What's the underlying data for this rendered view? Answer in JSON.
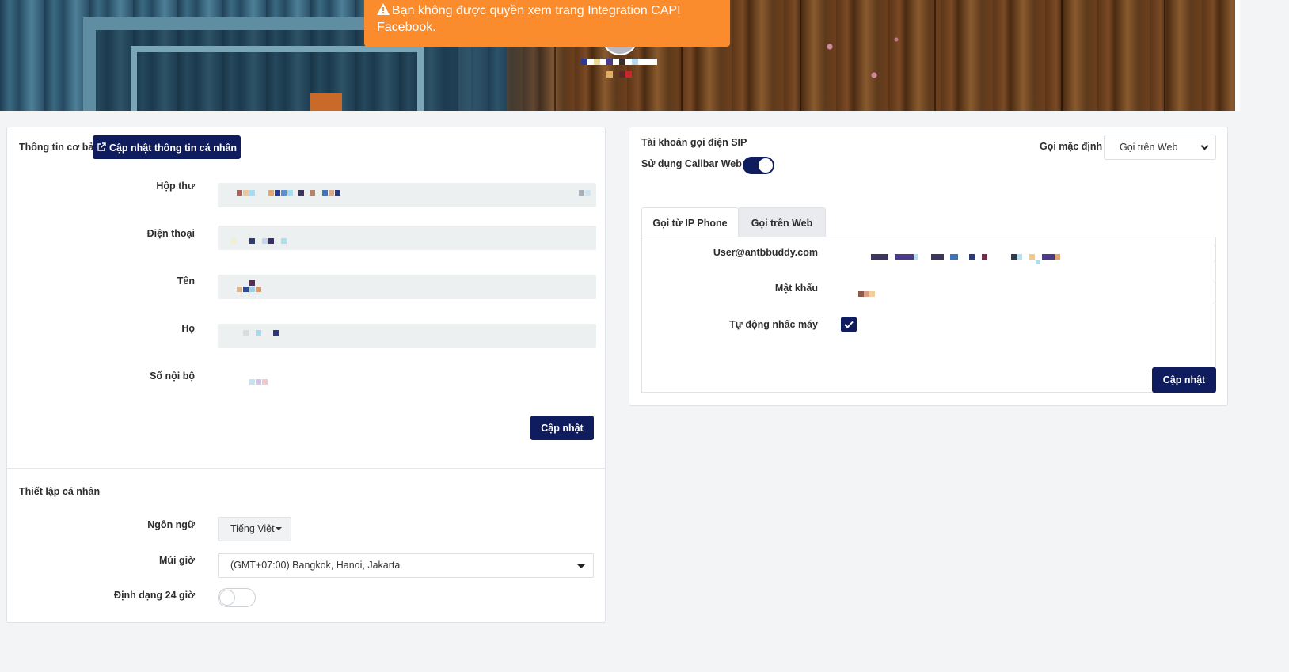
{
  "alert": {
    "icon": "warning-icon",
    "message": "Bạn không được quyền xem trang Integration CAPI Facebook."
  },
  "basic_info": {
    "title": "Thông tin cơ bản",
    "update_profile_label": "Cập nhật thông tin cá nhân",
    "update_profile_icon": "external-link-icon",
    "fields": {
      "email": "Hộp thư",
      "phone": "Điện thoại",
      "first_name": "Tên",
      "last_name": "Họ",
      "extension": "Số nội bộ"
    },
    "submit_label": "Cập nhật"
  },
  "personal_settings": {
    "title": "Thiết lập cá nhân",
    "language_label": "Ngôn ngữ",
    "language_value": "Tiếng Việt",
    "timezone_label": "Múi giờ",
    "timezone_value": "(GMT+07:00) Bangkok, Hanoi, Jakarta",
    "format24_label": "Định dạng 24 giờ",
    "format24_enabled": false
  },
  "sip": {
    "title": "Tài khoản gọi điện SIP",
    "callbar_label": "Sử dụng Callbar Web",
    "callbar_enabled": true,
    "default_call_label": "Gọi mặc định",
    "default_call_value": "Gọi trên Web",
    "tabs": [
      {
        "label": "Gọi từ IP Phone",
        "active": true
      },
      {
        "label": "Gọi trên Web",
        "active": false
      }
    ],
    "user_label": "User@antbbuddy.com",
    "password_label": "Mật khẩu",
    "auto_answer_label": "Tự động nhấc máy",
    "auto_answer_checked": true,
    "submit_label": "Cập nhật"
  },
  "colors": {
    "navy": "#0f1d5e",
    "alert": "#fb8c2e"
  }
}
